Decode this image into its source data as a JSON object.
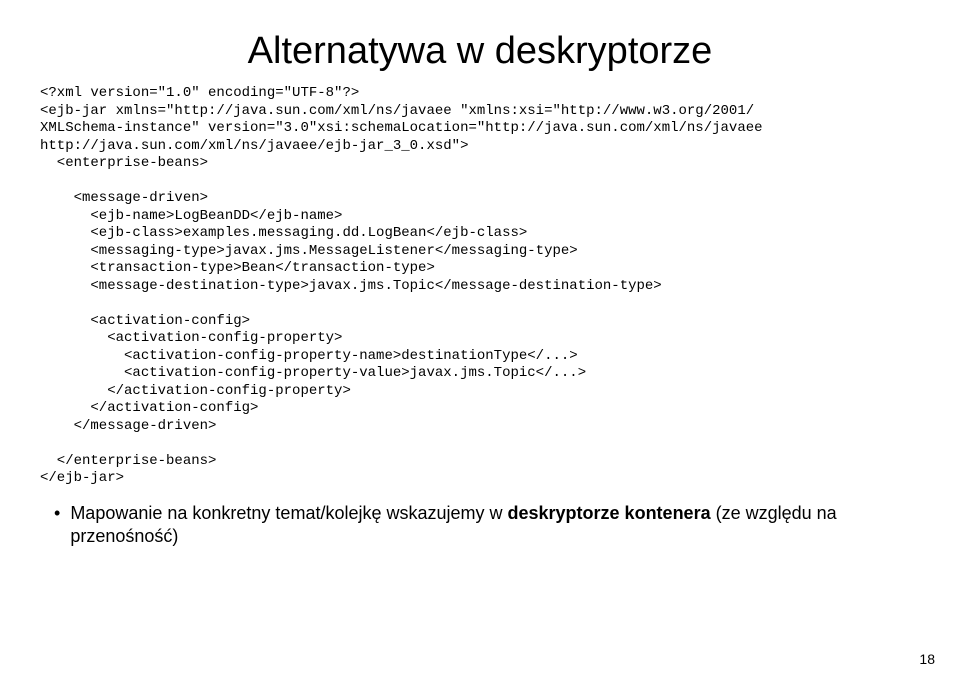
{
  "title": "Alternatywa w deskryptorze",
  "code": {
    "l01": "<?xml version=\"1.0\" encoding=\"UTF-8\"?>",
    "l02": "<ejb-jar xmlns=\"http://java.sun.com/xml/ns/javaee \"xmlns:xsi=\"http://www.w3.org/2001/",
    "l03": "XMLSchema-instance\" version=\"3.0\"xsi:schemaLocation=\"http://java.sun.com/xml/ns/javaee",
    "l04": "http://java.sun.com/xml/ns/javaee/ejb-jar_3_0.xsd\">",
    "l05": "  <enterprise-beans>",
    "l06": "",
    "l07": "    <message-driven>",
    "l08": "      <ejb-name>LogBeanDD</ejb-name>",
    "l09": "      <ejb-class>examples.messaging.dd.LogBean</ejb-class>",
    "l10": "      <messaging-type>javax.jms.MessageListener</messaging-type>",
    "l11": "      <transaction-type>Bean</transaction-type>",
    "l12": "      <message-destination-type>javax.jms.Topic</message-destination-type>",
    "l13": "",
    "l14": "      <activation-config>",
    "l15": "        <activation-config-property>",
    "l16": "          <activation-config-property-name>destinationType</...>",
    "l17": "          <activation-config-property-value>javax.jms.Topic</...>",
    "l18": "        </activation-config-property>",
    "l19": "      </activation-config>",
    "l20": "    </message-driven>",
    "l21": "",
    "l22": "  </enterprise-beans>",
    "l23": "</ejb-jar>"
  },
  "bullet": {
    "pre": "Mapowanie na konkretny temat/kolejkę wskazujemy w ",
    "bold": "deskryptorze kontenera",
    "post": " (ze względu na przenośność)"
  },
  "pageNumber": "18"
}
